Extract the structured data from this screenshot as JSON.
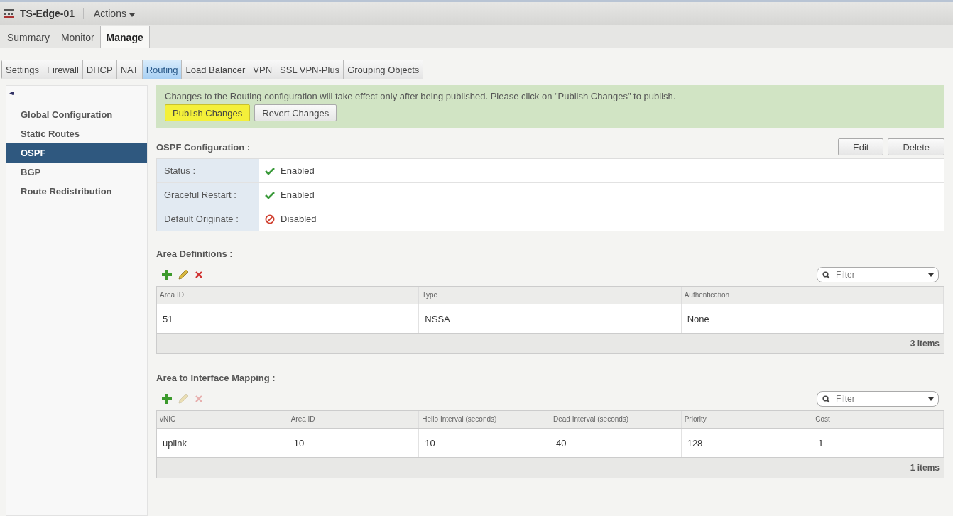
{
  "header": {
    "title": "TS-Edge-01",
    "actions": "Actions"
  },
  "tabs": [
    {
      "label": "Summary",
      "selected": false
    },
    {
      "label": "Monitor",
      "selected": false
    },
    {
      "label": "Manage",
      "selected": true
    }
  ],
  "subtabs": [
    {
      "label": "Settings",
      "selected": false
    },
    {
      "label": "Firewall",
      "selected": false
    },
    {
      "label": "DHCP",
      "selected": false
    },
    {
      "label": "NAT",
      "selected": false
    },
    {
      "label": "Routing",
      "selected": true
    },
    {
      "label": "Load Balancer",
      "selected": false
    },
    {
      "label": "VPN",
      "selected": false
    },
    {
      "label": "SSL VPN-Plus",
      "selected": false
    },
    {
      "label": "Grouping Objects",
      "selected": false
    }
  ],
  "sidebar": {
    "collapse": "◂◂",
    "items": [
      {
        "label": "Global Configuration",
        "selected": false
      },
      {
        "label": "Static Routes",
        "selected": false
      },
      {
        "label": "OSPF",
        "selected": true
      },
      {
        "label": "BGP",
        "selected": false
      },
      {
        "label": "Route Redistribution",
        "selected": false
      }
    ]
  },
  "notice": {
    "message": "Changes to the Routing configuration will take effect only after being published. Please click on \"Publish Changes\" to publish.",
    "buttons": [
      {
        "label": "Publish Changes",
        "highlighted": true
      },
      {
        "label": "Revert Changes",
        "highlighted": false
      }
    ]
  },
  "ospf": {
    "title": "OSPF Configuration :",
    "buttons": [
      "Edit",
      "Delete"
    ],
    "fields": [
      {
        "label": "Status :",
        "value": "Enabled",
        "kind": "enabled"
      },
      {
        "label": "Graceful Restart :",
        "value": "Enabled",
        "kind": "enabled"
      },
      {
        "label": "Default Originate :",
        "value": "Disabled",
        "kind": "disabled"
      }
    ]
  },
  "area_definitions": {
    "title": "Area Definitions :",
    "edit_disabled": false,
    "filter_placeholder": "Filter",
    "columns": [
      "Area ID",
      "Type",
      "Authentication"
    ],
    "rows": [
      [
        "51",
        "NSSA",
        "None"
      ]
    ],
    "count": "3 items"
  },
  "area_mapping": {
    "title": "Area to Interface Mapping :",
    "edit_disabled": true,
    "filter_placeholder": "Filter",
    "columns": [
      "vNIC",
      "Area ID",
      "Hello Interval (seconds)",
      "Dead Interval (seconds)",
      "Priority",
      "Cost"
    ],
    "rows": [
      [
        "uplink",
        "10",
        "10",
        "40",
        "128",
        "1"
      ]
    ],
    "count": "1 items"
  }
}
